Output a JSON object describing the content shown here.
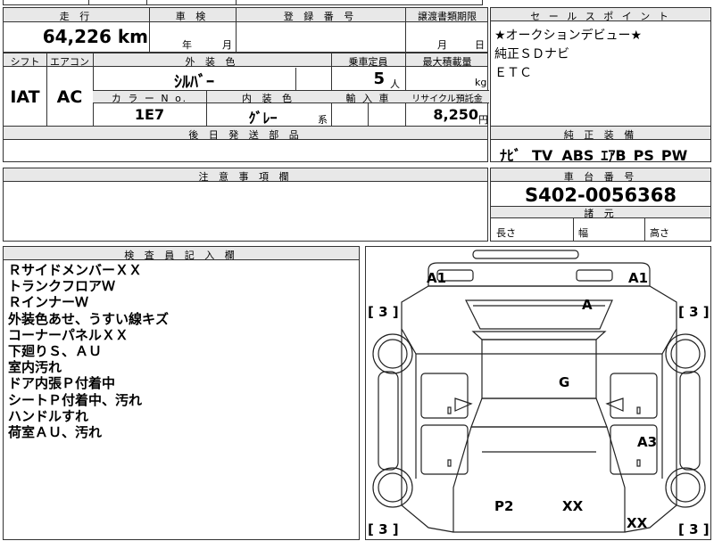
{
  "top_row": {
    "mileage_header": "走 行",
    "inspection_header": "車 検",
    "registration_header": "登 録 番 号",
    "transfer_header": "譲渡書類期限",
    "mileage_value": "64,226",
    "mileage_unit": "km",
    "inspection_year_label": "年",
    "inspection_month_label": "月",
    "transfer_month_label": "月",
    "transfer_day_label": "日"
  },
  "mid_row": {
    "shift_header": "シフト",
    "aircon_header": "エアコン",
    "exterior_header": "外 装 色",
    "capacity_header": "乗車定員",
    "load_header": "最大積載量",
    "shift_value": "IAT",
    "aircon_value": "AC",
    "exterior_value": "ｼﾙﾊﾞｰ",
    "capacity_value": "5",
    "capacity_unit": "人",
    "load_unit": "kg",
    "color_no_header": "カ ラ ー N o.",
    "interior_header": "内 装 色",
    "import_header": "輸 入 車",
    "recycle_header": "リサイクル預託金",
    "color_no_value": "1E7",
    "interior_value": "ｸﾞﾚｰ",
    "interior_suffix": "系",
    "recycle_value": "8,250",
    "recycle_unit": "円"
  },
  "later_parts_header": "後 日 発 送 部 品",
  "sales_points": {
    "header": "セ ー ル ス ポ イ ン ト",
    "lines": [
      "★オークションデビュー★",
      "純正ＳＤナビ",
      "ＥＴＣ"
    ]
  },
  "equipment": {
    "header": "純 正 装 備",
    "items": [
      "ﾅﾋﾞ",
      "TV",
      "ABS",
      "ｴｱB",
      "PS",
      "PW"
    ]
  },
  "caution_header": "注 意 事 項 欄",
  "chassis": {
    "header": "車 台 番 号",
    "value": "S402-0056368",
    "dims_header": "諸 元",
    "length_label": "長さ",
    "width_label": "幅",
    "height_label": "高さ"
  },
  "inspector": {
    "header": "検 査 員 記 入 欄",
    "notes": [
      "ＲサイドメンバーＸＸ",
      "トランクフロアＷ",
      "ＲインナーＷ",
      "外装色あせ、うすい線キズ",
      "コーナーパネルＸＸ",
      "下廻りＳ、ＡＵ",
      "室内汚れ",
      "ドア内張Ｐ付着中",
      "シートＰ付着中、汚れ",
      "ハンドルすれ",
      "荷室ＡＵ、汚れ"
    ]
  },
  "diagram": {
    "marks": {
      "rear_left": "A1",
      "rear_right": "A1",
      "rear_glass": "A",
      "roof": "G",
      "right_door": "A3",
      "hood_left": "P2",
      "hood_center": "XX",
      "front_right": "XX"
    },
    "tires": [
      "[ 3 ]",
      "[ 3 ]",
      "[ 3 ]",
      "[ 3 ]"
    ]
  }
}
